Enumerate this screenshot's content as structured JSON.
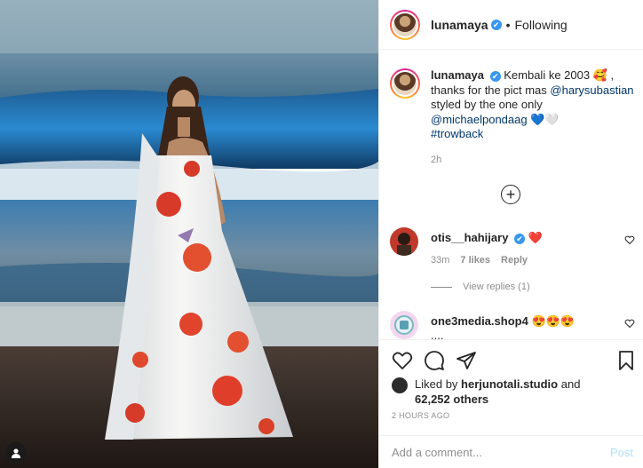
{
  "post": {
    "author": "lunamaya",
    "follow_status": "Following",
    "separator": "•",
    "verified_mark": "✔"
  },
  "caption": {
    "username": "lunamaya",
    "text_1": "Kembali ke 2003",
    "emoji_1": "🥰",
    "text_2": ", thanks for the pict mas",
    "mention_1": "@harysubastian",
    "text_3": "styled by the one only",
    "mention_2": "@michaelpondaag",
    "emoji_2": "💙🤍",
    "hashtag": "#trowback",
    "time": "2h"
  },
  "load_more_icon": "plus-circle-icon",
  "comments": [
    {
      "username": "otis__hahijary",
      "text": "❤️",
      "time": "33m",
      "likes": "7 likes",
      "reply_label": "Reply",
      "view_replies": "View replies (1)"
    },
    {
      "username": "one3media.shop4",
      "text": "😍😍😍",
      "more": "...."
    }
  ],
  "actions": {
    "like_icon": "heart-icon",
    "comment_icon": "comment-icon",
    "share_icon": "share-icon",
    "save_icon": "bookmark-icon"
  },
  "likes": {
    "prefix": "Liked by",
    "user": "herjunotali.studio",
    "and": "and",
    "others": "62,252 others"
  },
  "posted_ago": "2 HOURS AGO",
  "add_comment": {
    "placeholder": "Add a comment...",
    "post_label": "Post"
  },
  "colors": {
    "link": "#00376b",
    "verified": "#3897f0",
    "post_button_disabled": "#b2dffc",
    "heart_red": "#ed4956"
  }
}
